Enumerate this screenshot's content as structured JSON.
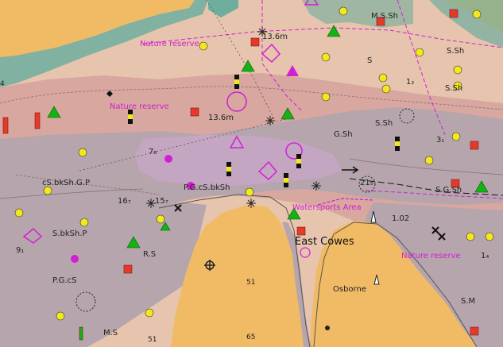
{
  "colors": {
    "land": "#f1bb66",
    "shallow": "#e7c4ad",
    "mid": "#d7a7a0",
    "channel": "#b6a5ad",
    "drying": "#6fae9d",
    "magenta": "#d21fd2",
    "buoy_yellow": "#f2e81b",
    "buoy_green": "#13b313",
    "buoy_red": "#e53a29"
  },
  "places": {
    "town": "East Cowes",
    "locality": "Osborne",
    "nature_reserve": "Nature reserve",
    "watersports_area": "Watersports Area"
  },
  "seabed": {
    "ms_sh": "M.S.Sh",
    "s": "S",
    "s_sh_1": "S.Sh",
    "s_sh_2": "S.Sh",
    "g_sh": "G.Sh",
    "s_sh_3": "S.Sh",
    "s_g_sh": "S.G.Sh",
    "pgcs_bksh": "P.G.cS.bkSh",
    "cs_bksh_gp": "cS.bkSh.G.P",
    "s_bksh_p": "S.bkSh.P",
    "r_s": "R.S",
    "pgcs": "P.G.cS",
    "ms": "M.S",
    "s_m": "S.M"
  },
  "depths": {
    "d1": "13.6m",
    "d2": "13.6m",
    "d3": "7₈",
    "d4": "16₇",
    "d5": "15₇",
    "d6": "21₅",
    "d7": "1₂",
    "d8": "3₁",
    "d9": "9₁",
    "d10": "1₄",
    "d11": "1.02",
    "d12": "51",
    "d13": "51",
    "d14": "65",
    "d15": "4"
  }
}
